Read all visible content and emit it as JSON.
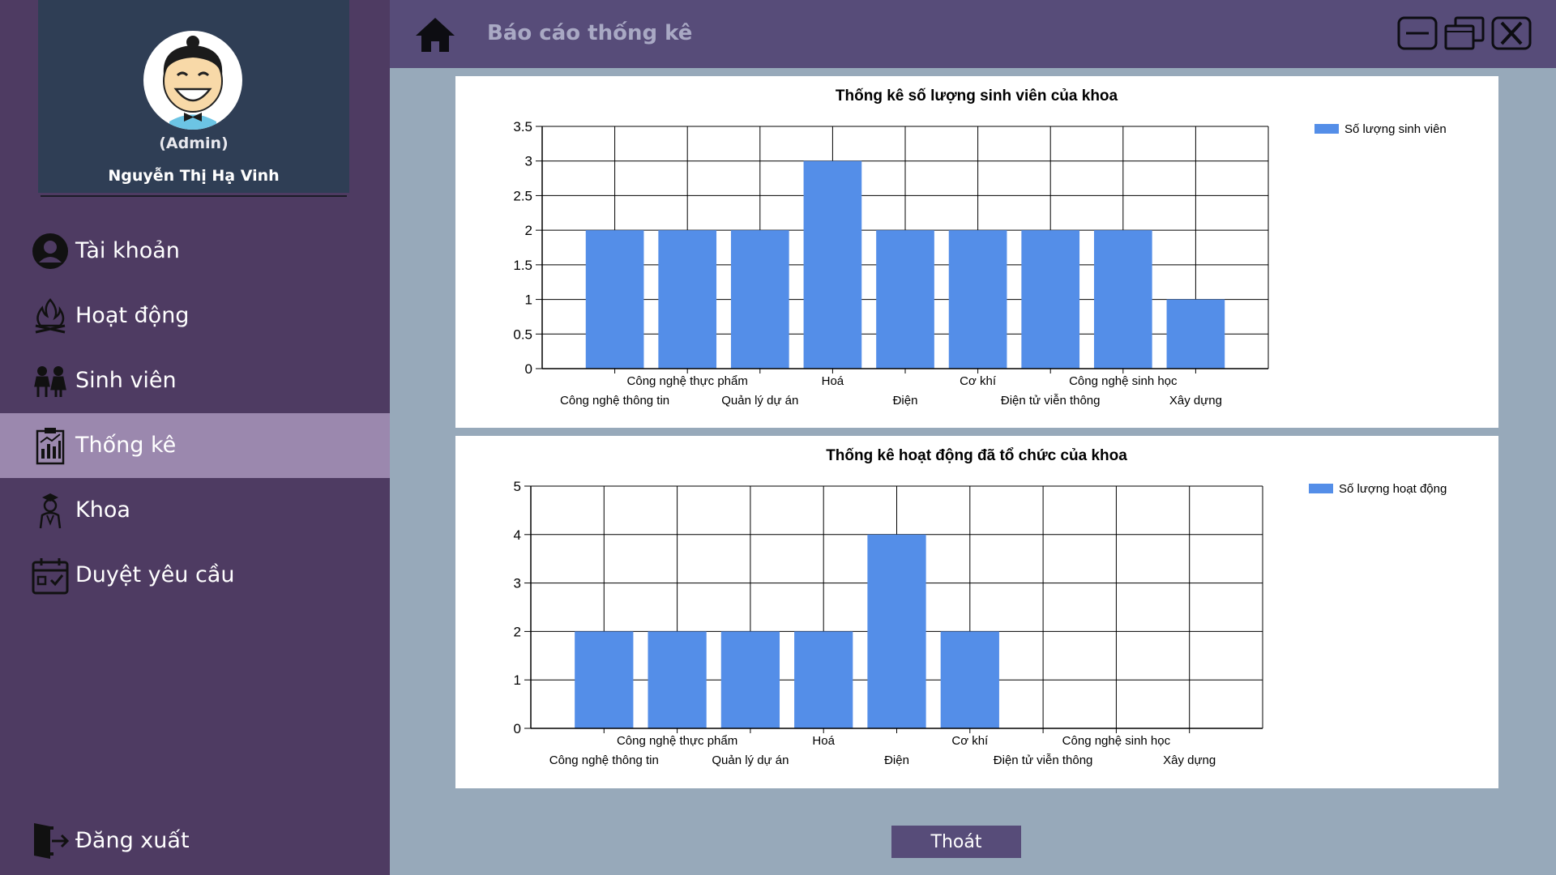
{
  "app": {
    "page_title": "Báo cáo thống kê"
  },
  "profile": {
    "role": "(Admin)",
    "name": "Nguyễn Thị Hạ Vinh"
  },
  "sidebar": {
    "items": [
      {
        "label": "Tài khoản",
        "icon": "user-circle-icon"
      },
      {
        "label": "Hoạt động",
        "icon": "campfire-icon"
      },
      {
        "label": "Sinh viên",
        "icon": "students-icon"
      },
      {
        "label": "Thống kê",
        "icon": "report-chart-icon",
        "active": true
      },
      {
        "label": "Khoa",
        "icon": "teacher-icon"
      },
      {
        "label": "Duyệt yêu cầu",
        "icon": "calendar-check-icon"
      }
    ],
    "logout_label": "Đăng xuất"
  },
  "footer": {
    "exit_label": "Thoát"
  },
  "colors": {
    "sidebar_bg": "#4e3b62",
    "sidebar_active": "#9b88ae",
    "topbar_bg": "#574c79",
    "content_bg": "#97a9ba",
    "bar": "#548ee8"
  },
  "chart_data": [
    {
      "type": "bar",
      "title": "Thống kê số lượng sinh viên của khoa",
      "categories": [
        "Công nghệ thông tin",
        "Công nghệ thực phẩm",
        "Quản lý dự án",
        "Hoá",
        "Điện",
        "Cơ khí",
        "Điện tử viễn thông",
        "Công nghệ sinh học",
        "Xây dựng"
      ],
      "series": [
        {
          "name": "Số lượng sinh viên",
          "values": [
            2,
            2,
            2,
            3,
            2,
            2,
            2,
            2,
            1
          ]
        }
      ],
      "yticks": [
        "0",
        "0.5",
        "1",
        "1.5",
        "2",
        "2.5",
        "3",
        "3.5"
      ],
      "ylim": [
        0,
        3.5
      ],
      "grid": true,
      "legend": "top-right"
    },
    {
      "type": "bar",
      "title": "Thống kê hoạt động đã tổ chức của khoa",
      "categories": [
        "Công nghệ thông tin",
        "Công nghệ thực phẩm",
        "Quản lý dự án",
        "Hoá",
        "Điện",
        "Cơ khí",
        "Điện tử viễn thông",
        "Công nghệ sinh học",
        "Xây dựng"
      ],
      "series": [
        {
          "name": "Số lượng hoạt động",
          "values": [
            2,
            2,
            2,
            2,
            4,
            2,
            0,
            0,
            0
          ]
        }
      ],
      "yticks": [
        "0",
        "1",
        "2",
        "3",
        "4",
        "5"
      ],
      "ylim": [
        0,
        5
      ],
      "grid": true,
      "legend": "top-right"
    }
  ]
}
